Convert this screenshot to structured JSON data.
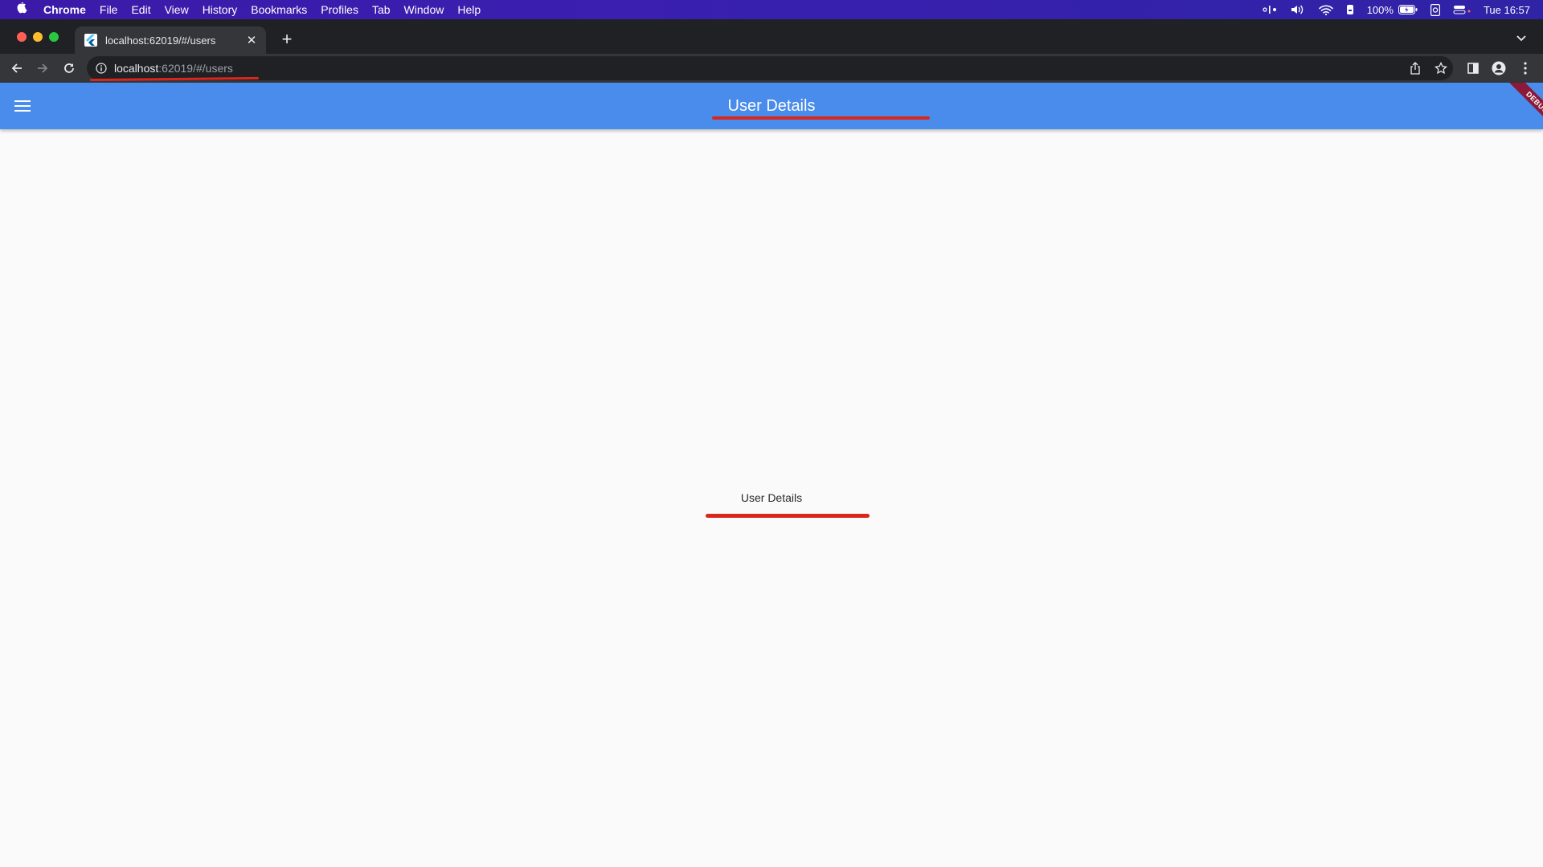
{
  "menubar": {
    "app_name": "Chrome",
    "items": [
      "File",
      "Edit",
      "View",
      "History",
      "Bookmarks",
      "Profiles",
      "Tab",
      "Window",
      "Help"
    ],
    "battery": "100%",
    "clock": "Tue 16:57"
  },
  "browser": {
    "tab_title": "localhost:62019/#/users",
    "url_host": "localhost",
    "url_path": ":62019/#/users"
  },
  "app": {
    "title": "User Details",
    "body_text": "User Details",
    "banner": "DEBUG",
    "appbar_color": "#4a8ceb"
  }
}
